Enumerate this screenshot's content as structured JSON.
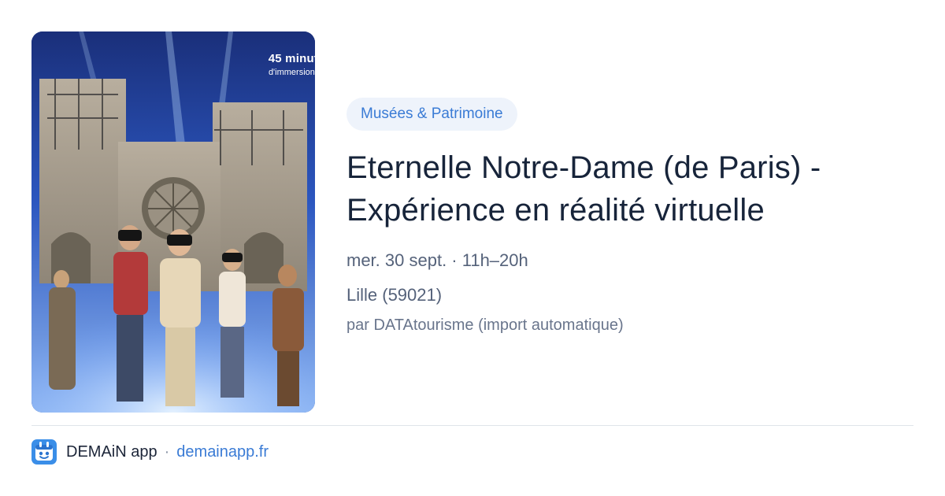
{
  "poster": {
    "caption_line1": "45 minut",
    "caption_line2": "d'immersion t"
  },
  "event": {
    "category": "Musées & Patrimoine",
    "title": "Eternelle Notre-Dame (de Paris) - Expérience en réalité virtuelle",
    "date_time": "mer. 30 sept. · 11h–20h",
    "location": "Lille (59021)",
    "source": "par DATAtourisme (import automatique)"
  },
  "footer": {
    "app_name": "DEMAiN app",
    "separator": "·",
    "url": "demainapp.fr"
  },
  "colors": {
    "accent": "#3a7bd5",
    "category_bg": "#eef3fb",
    "title": "#17243a",
    "meta": "#55627a"
  }
}
